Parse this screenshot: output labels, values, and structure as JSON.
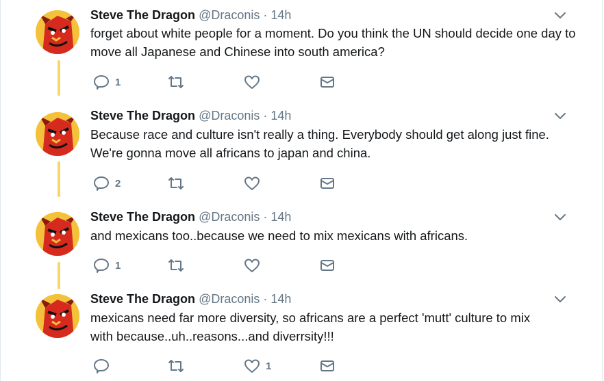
{
  "author": {
    "name": "Steve The Dragon",
    "handle": "@Draconis",
    "separator": "·",
    "time": "14h"
  },
  "tweets": [
    {
      "text": "forget about white people for a moment. Do you think the UN should decide one day to move all Japanese and Chinese into south america?",
      "reply_count": "1",
      "retweet_count": "",
      "like_count": ""
    },
    {
      "text": "Because race and culture isn't really a thing. Everybody should get along just fine. We're gonna move all africans to japan and china.",
      "reply_count": "2",
      "retweet_count": "",
      "like_count": ""
    },
    {
      "text": "and mexicans too..because we need to mix mexicans with africans.",
      "reply_count": "1",
      "retweet_count": "",
      "like_count": ""
    },
    {
      "text": "mexicans need far more diversity, so africans are a perfect 'mutt' culture to mix with because..uh..reasons...and diverrsity!!!",
      "reply_count": "",
      "retweet_count": "",
      "like_count": "1"
    }
  ],
  "icons": {
    "reply": "reply-icon",
    "retweet": "retweet-icon",
    "like": "heart-icon",
    "dm": "envelope-icon",
    "menu": "chevron-down-icon",
    "avatar": "dragon-avatar"
  },
  "colors": {
    "thread_line": "#f7d76b",
    "secondary_text": "#657786",
    "primary_text": "#14171a",
    "divider": "#e1e8ed"
  }
}
